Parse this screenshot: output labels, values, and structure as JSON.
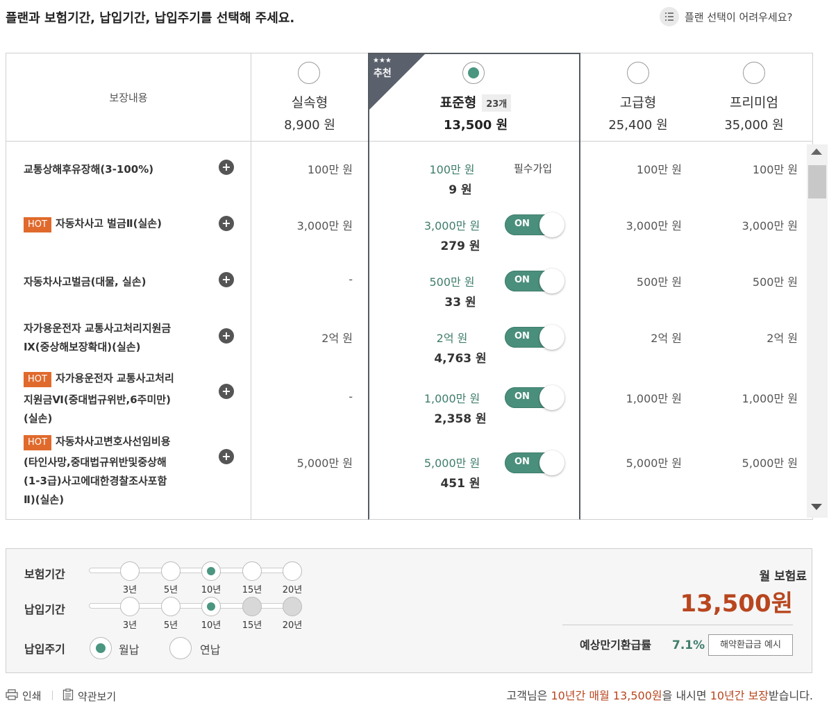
{
  "header": {
    "title": "플랜과 보험기간, 납입기간, 납입주기를 선택해 주세요.",
    "help_link": "플랜 선택이 어려우세요?"
  },
  "table": {
    "coverage_header": "보장내용",
    "recommend_badge": {
      "stars": "★★★",
      "text": "추천"
    },
    "plans": [
      {
        "name": "실속형",
        "price": "8,900 원",
        "selected": false
      },
      {
        "name": "표준형",
        "price": "13,500 원",
        "selected": true,
        "count": "23개"
      },
      {
        "name": "고급형",
        "price": "25,400 원",
        "selected": false
      },
      {
        "name": "프리미엄",
        "price": "35,000 원",
        "selected": false
      }
    ],
    "required_label": "필수가입",
    "toggle_on": "ON",
    "hot_label": "HOT",
    "rows": [
      {
        "lines": [
          "교통상해후유장해(3-100%)"
        ],
        "hot": false,
        "basic": "100만 원",
        "standard": "100만 원",
        "premium": "9 원",
        "advanced": "100만 원",
        "prime": "100만 원"
      },
      {
        "lines": [
          "자동차사고 벌금Ⅱ(실손)"
        ],
        "hot": true,
        "basic": "3,000만 원",
        "standard": "3,000만 원",
        "premium": "279 원",
        "advanced": "3,000만 원",
        "prime": "3,000만 원"
      },
      {
        "lines": [
          "자동차사고벌금(대물, 실손)"
        ],
        "hot": false,
        "basic": "-",
        "standard": "500만 원",
        "premium": "33 원",
        "advanced": "500만 원",
        "prime": "500만 원"
      },
      {
        "lines": [
          "자가용운전자 교통사고처리지원금",
          "Ⅸ(중상해보장확대)(실손)"
        ],
        "hot": false,
        "basic": "2억 원",
        "standard": "2억 원",
        "premium": "4,763 원",
        "advanced": "2억 원",
        "prime": "2억 원"
      },
      {
        "lines": [
          "자가용운전자 교통사고처리",
          "지원금Ⅵ(중대법규위반,6주미만)",
          "(실손)"
        ],
        "hot": true,
        "basic": "-",
        "standard": "1,000만 원",
        "premium": "2,358 원",
        "advanced": "1,000만 원",
        "prime": "1,000만 원"
      },
      {
        "lines": [
          "자동차사고변호사선임비용",
          "(타인사망,중대법규위반및중상해",
          "(1-3급)사고에대한경찰조사포함",
          "Ⅱ)(실손)"
        ],
        "hot": true,
        "basic": "5,000만 원",
        "standard": "5,000만 원",
        "premium": "451 원",
        "advanced": "5,000만 원",
        "prime": "5,000만 원"
      }
    ]
  },
  "settings": {
    "insurance_period": {
      "label": "보험기간",
      "options": [
        "3년",
        "5년",
        "10년",
        "15년",
        "20년"
      ],
      "selected": "10년"
    },
    "payment_period": {
      "label": "납입기간",
      "options": [
        "3년",
        "5년",
        "10년",
        "15년",
        "20년"
      ],
      "selected": "10년"
    },
    "payment_cycle": {
      "label": "납입주기",
      "options": [
        "월납",
        "연납"
      ],
      "selected": "월납"
    },
    "monthly_label": "월 보험료",
    "monthly_value": "13,500원",
    "refund_label": "예상만기환급률",
    "refund_value": "7.1%",
    "refund_button": "해약환급금 예시"
  },
  "footer": {
    "print": "인쇄",
    "terms": "약관보기",
    "summary": {
      "pre": "고객님은 ",
      "period": "10년간",
      "mid1": " 매월 ",
      "amount": "13,500원",
      "mid2": "을 내시면 ",
      "cover": "10년간 보장",
      "post": "받습니다."
    }
  },
  "colors": {
    "accent_green": "#4a9680",
    "accent_orange": "#b8461f",
    "hot": "#e06a2c"
  }
}
